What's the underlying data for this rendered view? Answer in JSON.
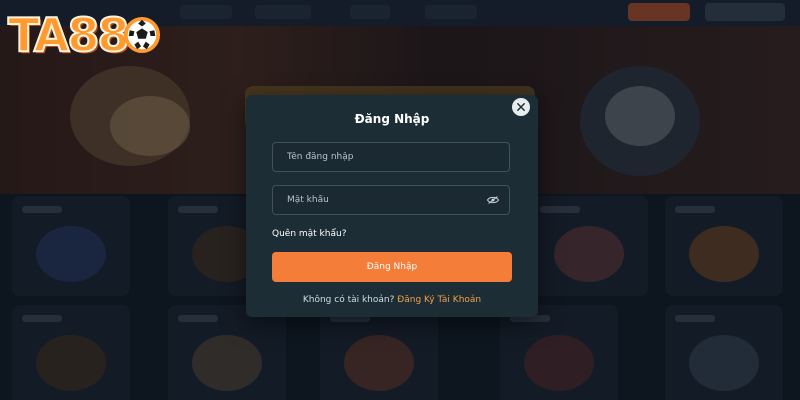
{
  "brand": {
    "logo_text": "TA88",
    "logo_icon": "soccer-ball-icon",
    "logo_color": "#ff9a2e"
  },
  "login_modal": {
    "title": "Đăng Nhập",
    "close_icon": "close-icon",
    "username": {
      "value": "",
      "placeholder": "Tên đăng nhập"
    },
    "password": {
      "value": "",
      "placeholder": "Mật khẩu",
      "toggle_icon": "eye-icon"
    },
    "forgot_label": "Quên mật khẩu?",
    "submit_label": "Đăng Nhập",
    "no_account_text": "Không có tài khoản?",
    "register_label": "Đăng Ký Tài Khoản"
  },
  "colors": {
    "accent": "#f47d3a",
    "modal_bg": "#1c2d36",
    "link": "#f4a04a"
  }
}
